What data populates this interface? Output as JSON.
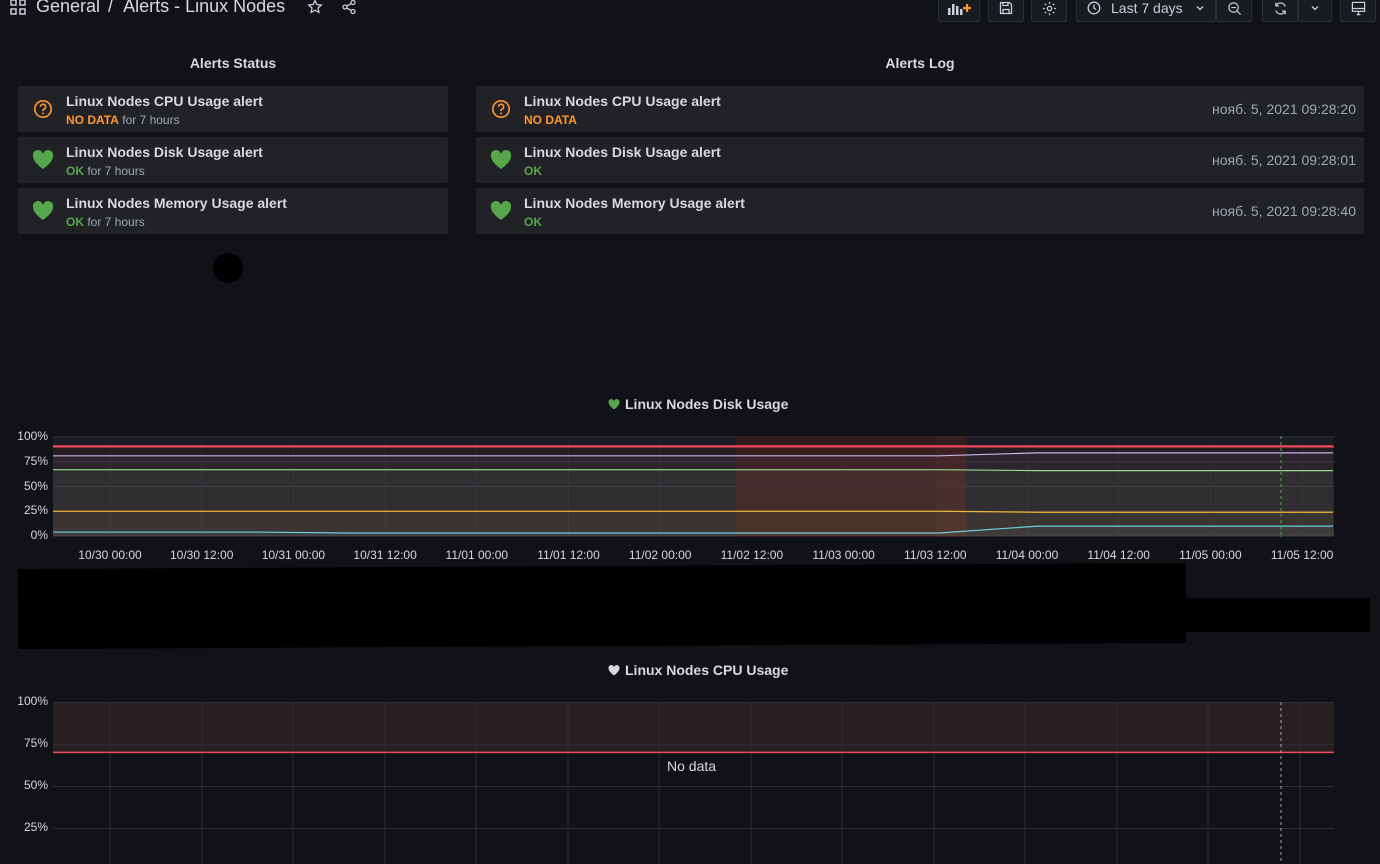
{
  "breadcrumb": {
    "root": "General",
    "separator": "/",
    "dashboard": "Alerts - Linux Nodes"
  },
  "toolbar": {
    "time_range": "Last 7 days"
  },
  "alerts_status": {
    "title": "Alerts Status",
    "items": [
      {
        "name": "Linux Nodes CPU Usage alert",
        "state": "NO DATA",
        "duration": "for 7 hours",
        "icon": "question-circle-icon"
      },
      {
        "name": "Linux Nodes Disk Usage alert",
        "state": "OK",
        "duration": "for 7 hours",
        "icon": "heart-icon"
      },
      {
        "name": "Linux Nodes Memory Usage alert",
        "state": "OK",
        "duration": "for 7 hours",
        "icon": "heart-icon"
      }
    ]
  },
  "alerts_log": {
    "title": "Alerts Log",
    "items": [
      {
        "name": "Linux Nodes CPU Usage alert",
        "state": "NO DATA",
        "time": "нояб. 5, 2021 09:28:20",
        "icon": "question-circle-icon"
      },
      {
        "name": "Linux Nodes Disk Usage alert",
        "state": "OK",
        "time": "нояб. 5, 2021 09:28:01",
        "icon": "heart-icon"
      },
      {
        "name": "Linux Nodes Memory Usage alert",
        "state": "OK",
        "time": "нояб. 5, 2021 09:28:40",
        "icon": "heart-icon"
      }
    ]
  },
  "colors": {
    "ok": "#56a64b",
    "no_data": "#ff9830",
    "threshold": "#f2495c",
    "background": "#111217",
    "panel": "#202226"
  },
  "chart_data": [
    {
      "type": "line",
      "title": "Linux Nodes Disk Usage",
      "y_ticks": [
        "100%",
        "75%",
        "50%",
        "25%",
        "0%"
      ],
      "x_ticks": [
        "10/30 00:00",
        "10/30 12:00",
        "10/31 00:00",
        "10/31 12:00",
        "11/01 00:00",
        "11/01 12:00",
        "11/02 00:00",
        "11/02 12:00",
        "11/03 00:00",
        "11/03 12:00",
        "11/04 00:00",
        "11/04 12:00",
        "11/05 00:00",
        "11/05 12:00"
      ],
      "ylim": [
        0,
        100
      ],
      "threshold": 90,
      "series": [
        {
          "color": "#f2495c",
          "values": [
            91,
            91,
            91,
            91,
            91,
            91,
            91,
            91,
            91,
            91,
            91,
            91,
            91,
            91
          ]
        },
        {
          "color": "#c4b6e6",
          "values": [
            81,
            81,
            81,
            81,
            81,
            81,
            81,
            81,
            81,
            81,
            84,
            84,
            84,
            84
          ]
        },
        {
          "color": "#96d98d",
          "values": [
            67,
            67,
            67,
            67,
            67,
            67,
            67,
            67,
            67,
            67,
            66,
            66,
            66,
            66
          ]
        },
        {
          "color": "#eab839",
          "values": [
            25,
            25,
            25,
            25,
            25,
            25,
            25,
            25,
            25,
            25,
            24,
            24,
            24,
            24
          ]
        },
        {
          "color": "#6ed0e0",
          "values": [
            4,
            4,
            4,
            3,
            3,
            3,
            3,
            3,
            3,
            3,
            10,
            10,
            10,
            10
          ]
        }
      ]
    },
    {
      "type": "line",
      "title": "Linux Nodes CPU Usage",
      "y_ticks": [
        "100%",
        "75%",
        "50%",
        "25%"
      ],
      "ylim": [
        0,
        100
      ],
      "threshold": 70,
      "series": [],
      "no_data_text": "No data"
    }
  ]
}
